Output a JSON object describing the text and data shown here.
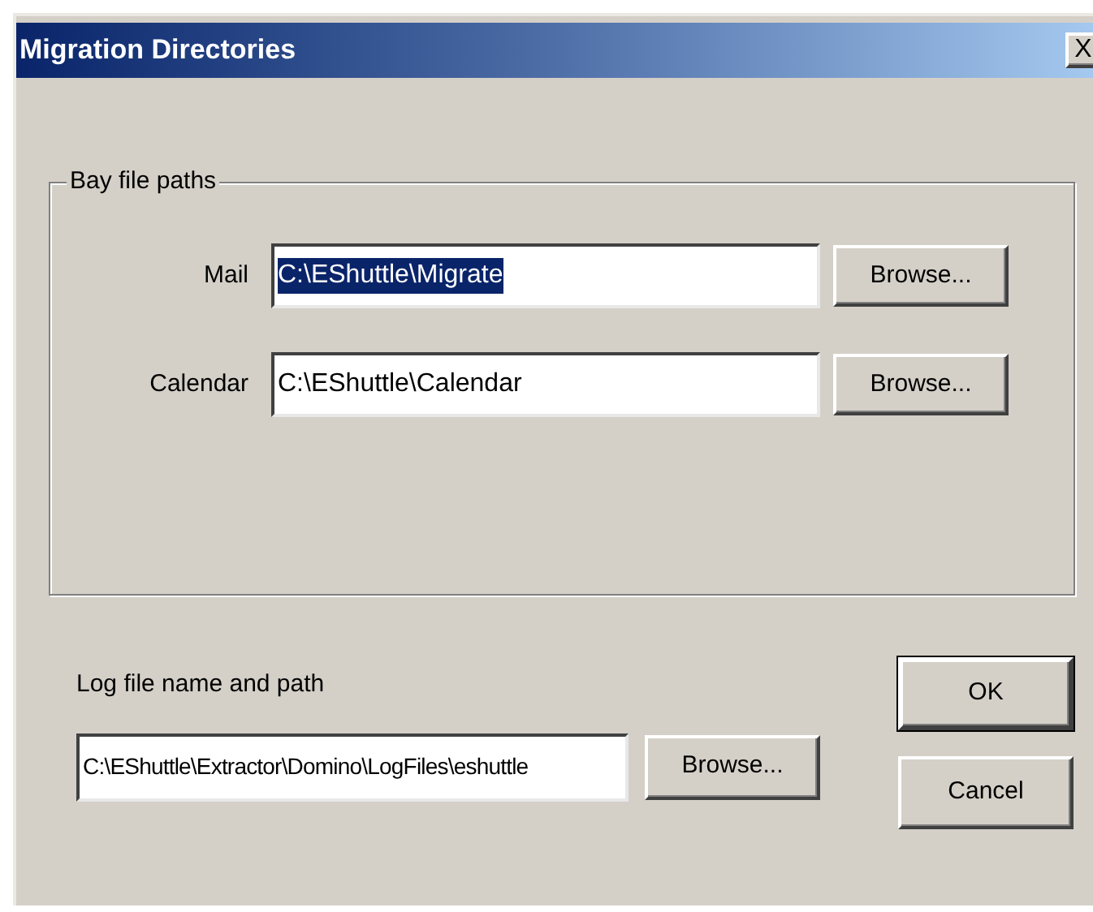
{
  "window": {
    "title": "Migration Directories",
    "close": "X"
  },
  "bay_group": {
    "title": "Bay file paths",
    "rows": [
      {
        "label": "Mail",
        "value": "C:\\EShuttle\\Migrate",
        "selected": true,
        "button": "Browse..."
      },
      {
        "label": "Calendar",
        "value": "C:\\EShuttle\\Calendar",
        "selected": false,
        "button": "Browse..."
      }
    ]
  },
  "log": {
    "label": "Log file name and path",
    "value": "C:\\EShuttle\\Extractor\\Domino\\LogFiles\\eshuttle",
    "button": "Browse..."
  },
  "buttons": [
    {
      "label": "OK",
      "default": true
    },
    {
      "label": "Cancel",
      "default": false
    }
  ]
}
